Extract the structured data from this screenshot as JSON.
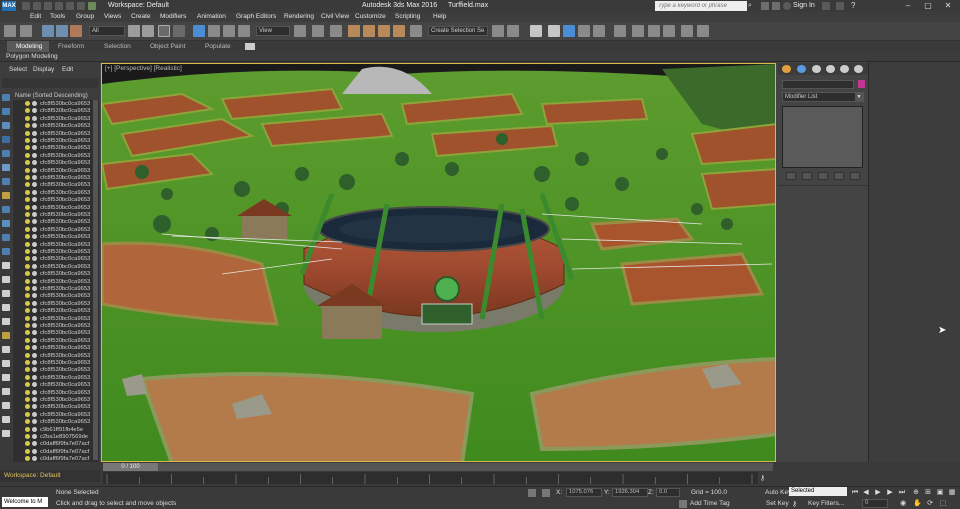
{
  "titlebar": {
    "logo": "MAX",
    "workspace": "Workspace: Default",
    "app_title": "Autodesk 3ds Max 2016",
    "file_name": "Turffield.max",
    "search_placeholder": "Type a keyword or phrase",
    "sign_in": "Sign In",
    "help": "?"
  },
  "menu": [
    "Edit",
    "Tools",
    "Group",
    "Views",
    "Create",
    "Modifiers",
    "Animation",
    "Graph Editors",
    "Rendering",
    "Civil View",
    "Customize",
    "Scripting",
    "Help"
  ],
  "toolbar": {
    "filter_value": "All",
    "view_value": "View",
    "selection_set_placeholder": "Create Selection Se"
  },
  "ribbon": {
    "tabs": [
      "Modeling",
      "Freeform",
      "Selection",
      "Object Paint",
      "Populate"
    ],
    "active": "Modeling",
    "sub_label": "Polygon Modeling"
  },
  "scene_explorer": {
    "tabs": [
      "Select",
      "Display",
      "Edit"
    ],
    "header": "Name (Sorted Descending)",
    "items": [
      "cfc8f530bc0ca9653",
      "cfc8f530bc0ca9653",
      "cfc8f530bc0ca9653",
      "cfc8f530bc0ca9653",
      "cfc8f530bc0ca9653",
      "cfc8f530bc0ca9653",
      "cfc8f530bc0ca9653",
      "cfc8f530bc0ca9653",
      "cfc8f530bc0ca9653",
      "cfc8f530bc0ca9653",
      "cfc8f530bc0ca9653",
      "cfc8f530bc0ca9653",
      "cfc8f530bc0ca9653",
      "cfc8f530bc0ca9653",
      "cfc8f530bc0ca9653",
      "cfc8f530bc0ca9653",
      "cfc8f530bc0ca9653",
      "cfc8f530bc0ca9653",
      "cfc8f530bc0ca9653",
      "cfc8f530bc0ca9653",
      "cfc8f530bc0ca9653",
      "cfc8f530bc0ca9653",
      "cfc8f530bc0ca9653",
      "cfc8f530bc0ca9653",
      "cfc8f530bc0ca9653",
      "cfc8f530bc0ca9653",
      "cfc8f530bc0ca9653",
      "cfc8f530bc0ca9653",
      "cfc8f530bc0ca9653",
      "cfc8f530bc0ca9653",
      "cfc8f530bc0ca9653",
      "cfc8f530bc0ca9653",
      "cfc8f530bc0ca9653",
      "cfc8f530bc0ca9653",
      "cfc8f530bc0ca9653",
      "cfc8f530bc0ca9653",
      "cfc8f530bc0ca9653",
      "cfc8f530bc0ca9653",
      "cfc8f530bc0ca9653",
      "cfc8f530bc0ca9653",
      "cfc8f530bc0ca9653",
      "cfc8f530bc0ca9653",
      "cfc8f530bc0ca9653",
      "cfc8f530bc0ca9653",
      "c9b61ff91fb4e5e",
      "c2ba1e8907569de",
      "c0daff6f9fa7e07acf",
      "c0daff6f9fa7e07acf",
      "c0daff6f9fa7e07acf"
    ]
  },
  "viewport": {
    "label": "[+] [Perspective] [Realistic]"
  },
  "command_panel": {
    "modifier_list": "Modifier List",
    "accent_color": "#c2348f"
  },
  "timeline": {
    "workspace": "Workspace: Default",
    "slider": "0 / 100",
    "position": 0,
    "total": 100
  },
  "status": {
    "welcome": "Welcome to M",
    "selection": "None Selected",
    "hint": "Click and drag to select and move objects",
    "x_label": "X:",
    "x_value": "1075.076",
    "y_label": "Y:",
    "y_value": "1926.304",
    "z_label": "Z:",
    "z_value": "0.0",
    "grid": "Grid = 100.0",
    "add_time_tag": "Add Time Tag",
    "auto_key": "Auto Key",
    "set_key": "Set Key",
    "selected_dropdown": "Selected",
    "key_filters": "Key Filters...",
    "frame": "0"
  }
}
